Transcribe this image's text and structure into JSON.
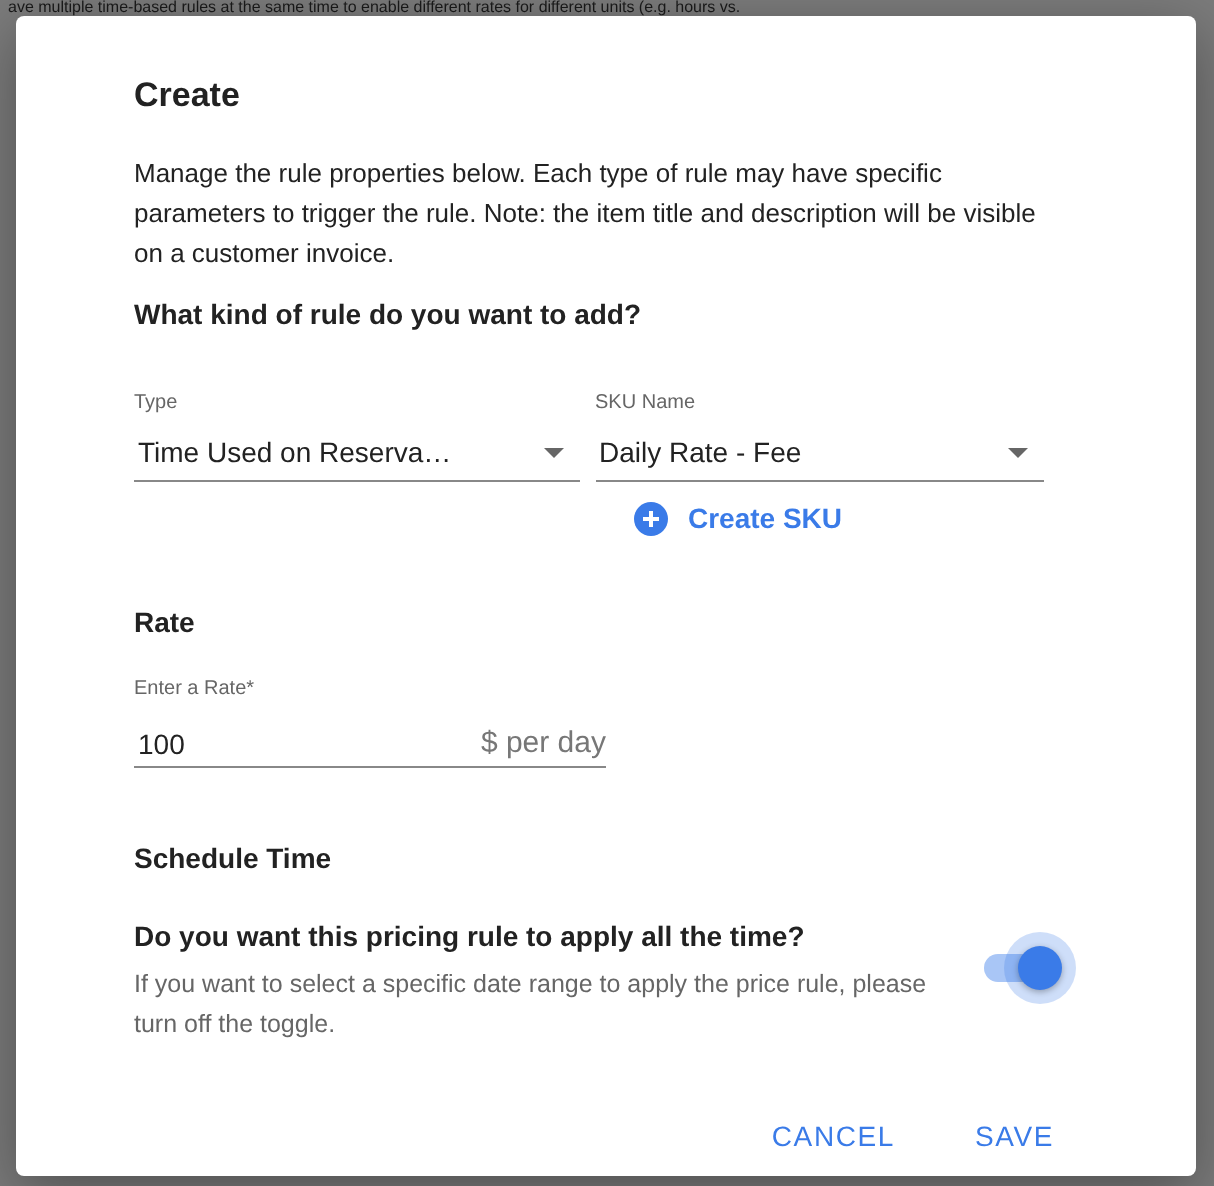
{
  "background": {
    "text": "ave multiple time-based rules at the same time to enable different rates for different units (e.g. hours vs."
  },
  "dialog": {
    "title": "Create",
    "description": "Manage the rule properties below. Each type of rule may have specific parameters to trigger the rule. Note: the item title and description will be visible on a customer invoice.",
    "question": "What kind of rule do you want to add?",
    "selects": [
      {
        "label": "Type",
        "value": "Time Used on Reserva…"
      },
      {
        "label": "SKU Name",
        "value": "Daily Rate - Fee"
      }
    ],
    "create_link": "Create SKU",
    "rate_heading": "Rate",
    "rate_field": {
      "label": "Enter a Rate*",
      "value": "100",
      "suffix": "$ per day"
    },
    "schedule_heading": "Schedule Time",
    "toggle": {
      "title": "Do you want this pricing rule to apply all the time?",
      "hint": "If you want to select a specific date range to apply the price rule, please turn off the toggle.",
      "on": true
    },
    "buttons": [
      "CANCEL",
      "SAVE"
    ]
  }
}
